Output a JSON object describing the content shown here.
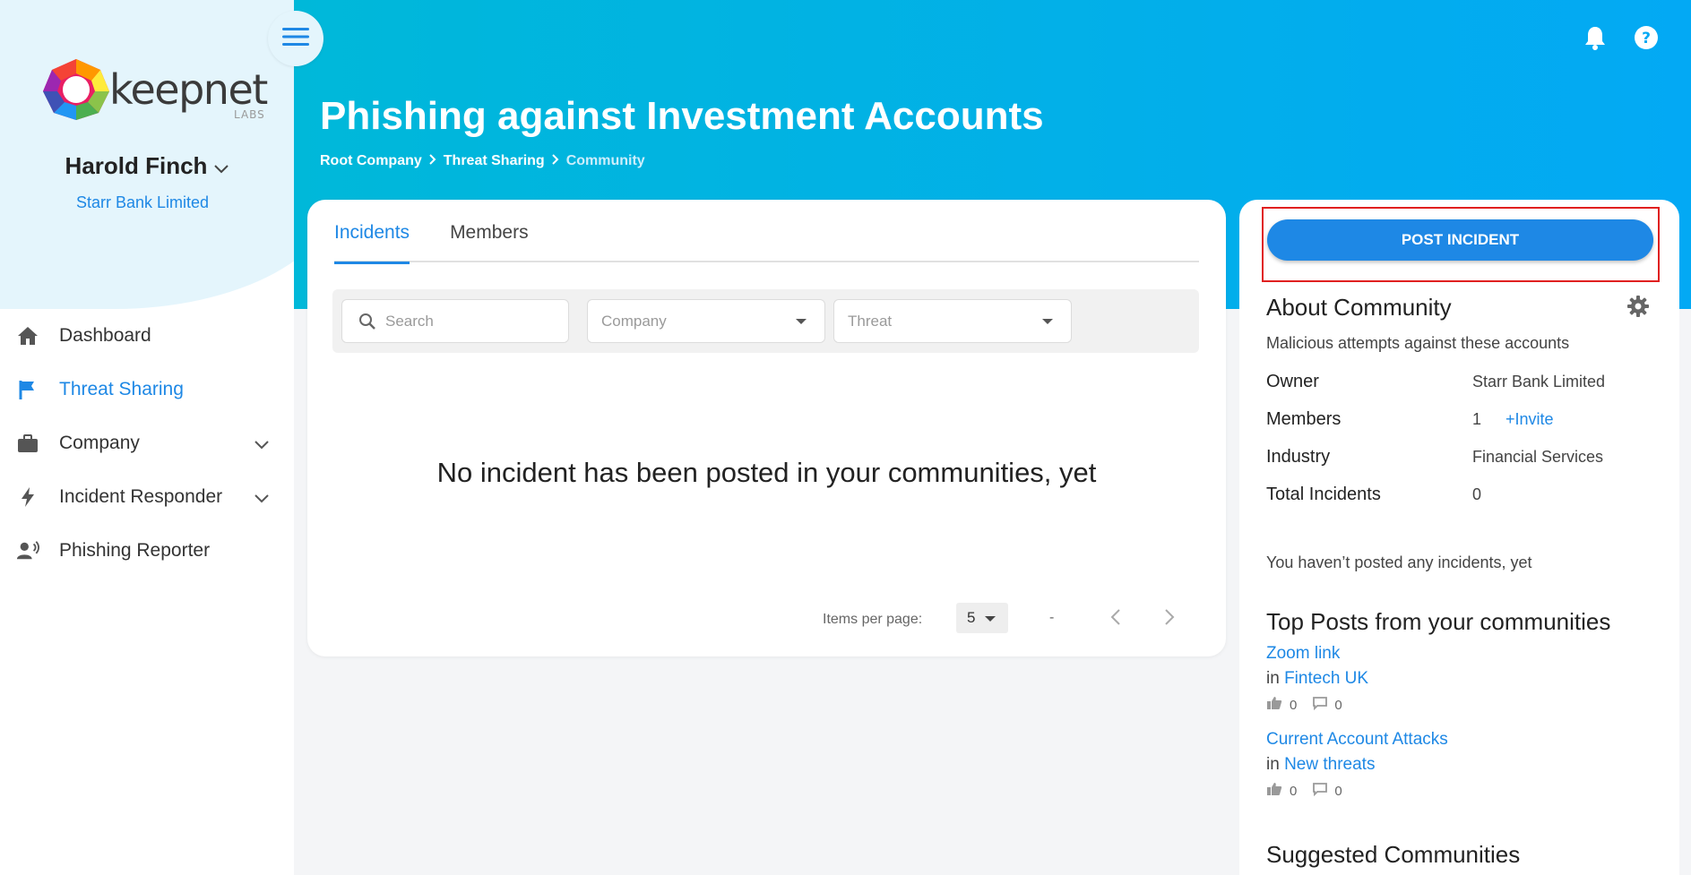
{
  "colors": {
    "accent": "#1e88e5",
    "header_start": "#00b8d9",
    "header_end": "#03a9f4",
    "highlight": "#e02020"
  },
  "sidebar": {
    "logo_text": "keepnet",
    "logo_sub": "LABS",
    "user_name": "Harold Finch",
    "user_company": "Starr Bank Limited",
    "items": [
      {
        "label": "Dashboard",
        "icon": "home-icon"
      },
      {
        "label": "Threat Sharing",
        "icon": "flag-icon",
        "active": true
      },
      {
        "label": "Company",
        "icon": "briefcase-icon",
        "expandable": true
      },
      {
        "label": "Incident Responder",
        "icon": "bolt-icon",
        "expandable": true
      },
      {
        "label": "Phishing Reporter",
        "icon": "person-voice-icon"
      }
    ]
  },
  "header": {
    "title": "Phishing against Investment Accounts",
    "breadcrumb": [
      "Root Company",
      "Threat Sharing",
      "Community"
    ]
  },
  "main": {
    "tabs": [
      "Incidents",
      "Members"
    ],
    "search_placeholder": "Search",
    "company_placeholder": "Company",
    "threat_placeholder": "Threat",
    "empty_message": "No incident has been posted in your communities, yet",
    "pager": {
      "items_per_page_label": "Items per page:",
      "items_per_page": "5",
      "range": "-"
    }
  },
  "side": {
    "post_button": "POST INCIDENT",
    "about_title": "About Community",
    "about_desc": "Malicious attempts against these accounts",
    "owner_label": "Owner",
    "owner_value": "Starr Bank Limited",
    "members_label": "Members",
    "members_value": "1",
    "invite_label": "+Invite",
    "industry_label": "Industry",
    "industry_value": "Financial Services",
    "total_label": "Total Incidents",
    "total_value": "0",
    "no_posts": "You haven’t posted any incidents, yet",
    "top_posts_title": "Top Posts from your communities",
    "in_word": "in",
    "top_posts": [
      {
        "title": "Zoom link",
        "community": "Fintech UK",
        "likes": "0",
        "comments": "0"
      },
      {
        "title": "Current Account Attacks",
        "community": "New threats",
        "likes": "0",
        "comments": "0"
      }
    ],
    "suggested_title": "Suggested Communities"
  }
}
